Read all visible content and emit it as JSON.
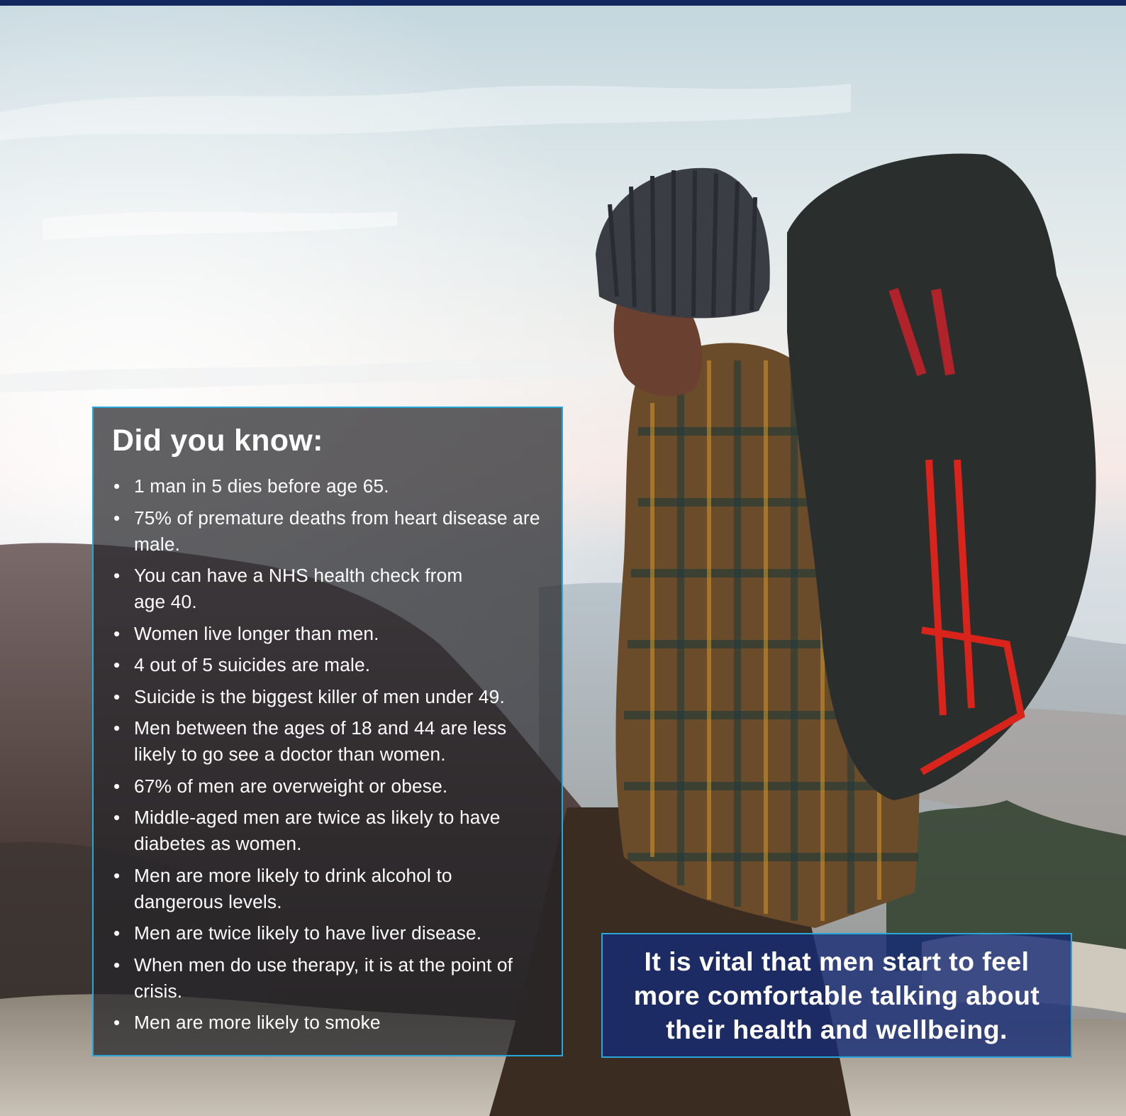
{
  "facts_panel": {
    "title": "Did you know:",
    "items": [
      "1 man in 5 dies before age 65.",
      "75% of premature deaths from heart disease are male.",
      "You can have a NHS health check from age 40.",
      "Women live longer than men.",
      "4 out of 5 suicides are male.",
      "Suicide is the biggest killer of men under 49.",
      "Men between the ages of 18 and 44 are less likely to go see a doctor than women.",
      "67% of men are overweight or obese.",
      "Middle-aged men are twice as likely to have diabetes as women.",
      "Men are more likely to drink alcohol to dangerous levels.",
      "Men are twice likely to have liver disease.",
      "When men do use therapy, it is at the point of crisis.",
      "Men are more likely to smoke"
    ]
  },
  "quote": {
    "text": "It is vital that men start to feel more comfortable talking about their health and wellbeing."
  },
  "colors": {
    "top_bar": "#13285f",
    "panel_border": "#2aa7d8",
    "quote_background": "#162c76"
  }
}
